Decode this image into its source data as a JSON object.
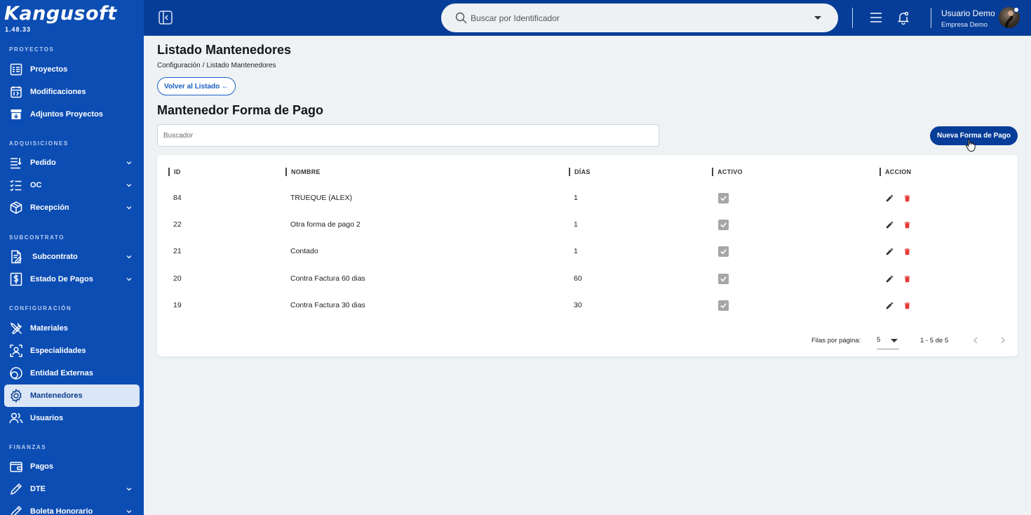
{
  "brand": {
    "name": "Kangusoft",
    "version": "1.48.33"
  },
  "sidebar": {
    "sections": [
      {
        "title": "PROYECTOS",
        "items": [
          {
            "label": "Proyectos",
            "icon": "project-list-icon",
            "expandable": false
          },
          {
            "label": "Modificaciones",
            "icon": "calendar-edit-icon",
            "expandable": false
          },
          {
            "label": "Adjuntos Proyectos",
            "icon": "archive-download-icon",
            "expandable": false
          }
        ]
      },
      {
        "title": "ADQUISICIONES",
        "items": [
          {
            "label": "Pedido",
            "icon": "list-lines-icon",
            "expandable": true
          },
          {
            "label": "OC",
            "icon": "checklist-icon",
            "expandable": true
          },
          {
            "label": "Recepción",
            "icon": "package-box-icon",
            "expandable": true
          }
        ]
      },
      {
        "title": "SUBCONTRATO",
        "items": [
          {
            "label": "Subcontrato",
            "icon": "document-edit-icon",
            "expandable": true
          },
          {
            "label": "Estado De Pagos",
            "icon": "dollar-document-icon",
            "expandable": true
          }
        ]
      },
      {
        "title": "CONFIGURACIÓN",
        "items": [
          {
            "label": "Materiales",
            "icon": "tools-icon",
            "expandable": false
          },
          {
            "label": "Especialidades",
            "icon": "user-focus-icon",
            "expandable": false
          },
          {
            "label": "Entidad Externas",
            "icon": "rings-icon",
            "expandable": false
          },
          {
            "label": "Mantenedores",
            "icon": "gear-icon",
            "expandable": false,
            "active": true
          },
          {
            "label": "Usuarios",
            "icon": "users-icon",
            "expandable": false
          }
        ]
      },
      {
        "title": "FINANZAS",
        "items": [
          {
            "label": "Pagos",
            "icon": "wallet-icon",
            "expandable": false
          },
          {
            "label": "DTE",
            "icon": "pencil-icon",
            "expandable": true
          },
          {
            "label": "Boleta Honorario",
            "icon": "pencil-icon",
            "expandable": true
          }
        ]
      }
    ]
  },
  "header": {
    "search_placeholder": "Buscar por Identificador",
    "user_name": "Usuario Demo",
    "company": "Empresa Demo"
  },
  "page": {
    "title": "Listado Mantenedores",
    "breadcrumb": [
      "Configuración",
      "Listado Mantenedores"
    ],
    "back_label": "Volver al Listado ←",
    "section_title": "Mantenedor Forma de Pago",
    "search_placeholder": "Buscador",
    "new_button": "Nueva Forma de Pago"
  },
  "table": {
    "columns": [
      "ID",
      "NOMBRE",
      "DÍAS",
      "ACTIVO",
      "ACCION"
    ],
    "rows": [
      {
        "id": "84",
        "nombre": "TRUEQUE (ALEX)",
        "dias": "1",
        "activo": true
      },
      {
        "id": "22",
        "nombre": "Otra forma de pago 2",
        "dias": "1",
        "activo": true
      },
      {
        "id": "21",
        "nombre": "Contado",
        "dias": "1",
        "activo": true
      },
      {
        "id": "20",
        "nombre": "Contra Factura 60 dias",
        "dias": "60",
        "activo": true
      },
      {
        "id": "19",
        "nombre": "Contra Factura 30 dias",
        "dias": "30",
        "activo": true
      }
    ]
  },
  "pagination": {
    "rows_per_page_label": "Filas por página:",
    "rows_per_page": "5",
    "range": "1 - 5 de 5"
  },
  "colors": {
    "sidebar": "#0c4db3",
    "topbar": "#063d98",
    "primary": "#1a5fc2",
    "delete": "#e53935"
  }
}
